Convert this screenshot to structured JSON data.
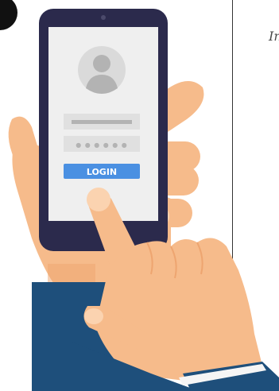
{
  "login_screen": {
    "button_label": "LOGIN",
    "password_dots": "● ● ● ● ● ●"
  },
  "side_text": "In",
  "icons": {
    "avatar": "user-avatar-icon",
    "camera": "front-camera-icon"
  },
  "colors": {
    "phone_body": "#2b2a4c",
    "screen_bg": "#efefef",
    "login_button": "#4a90e2",
    "skin": "#f6bb8b",
    "skin_shadow": "#eea570",
    "sleeve": "#1e4f7b",
    "cuff": "#f5f5f5"
  }
}
